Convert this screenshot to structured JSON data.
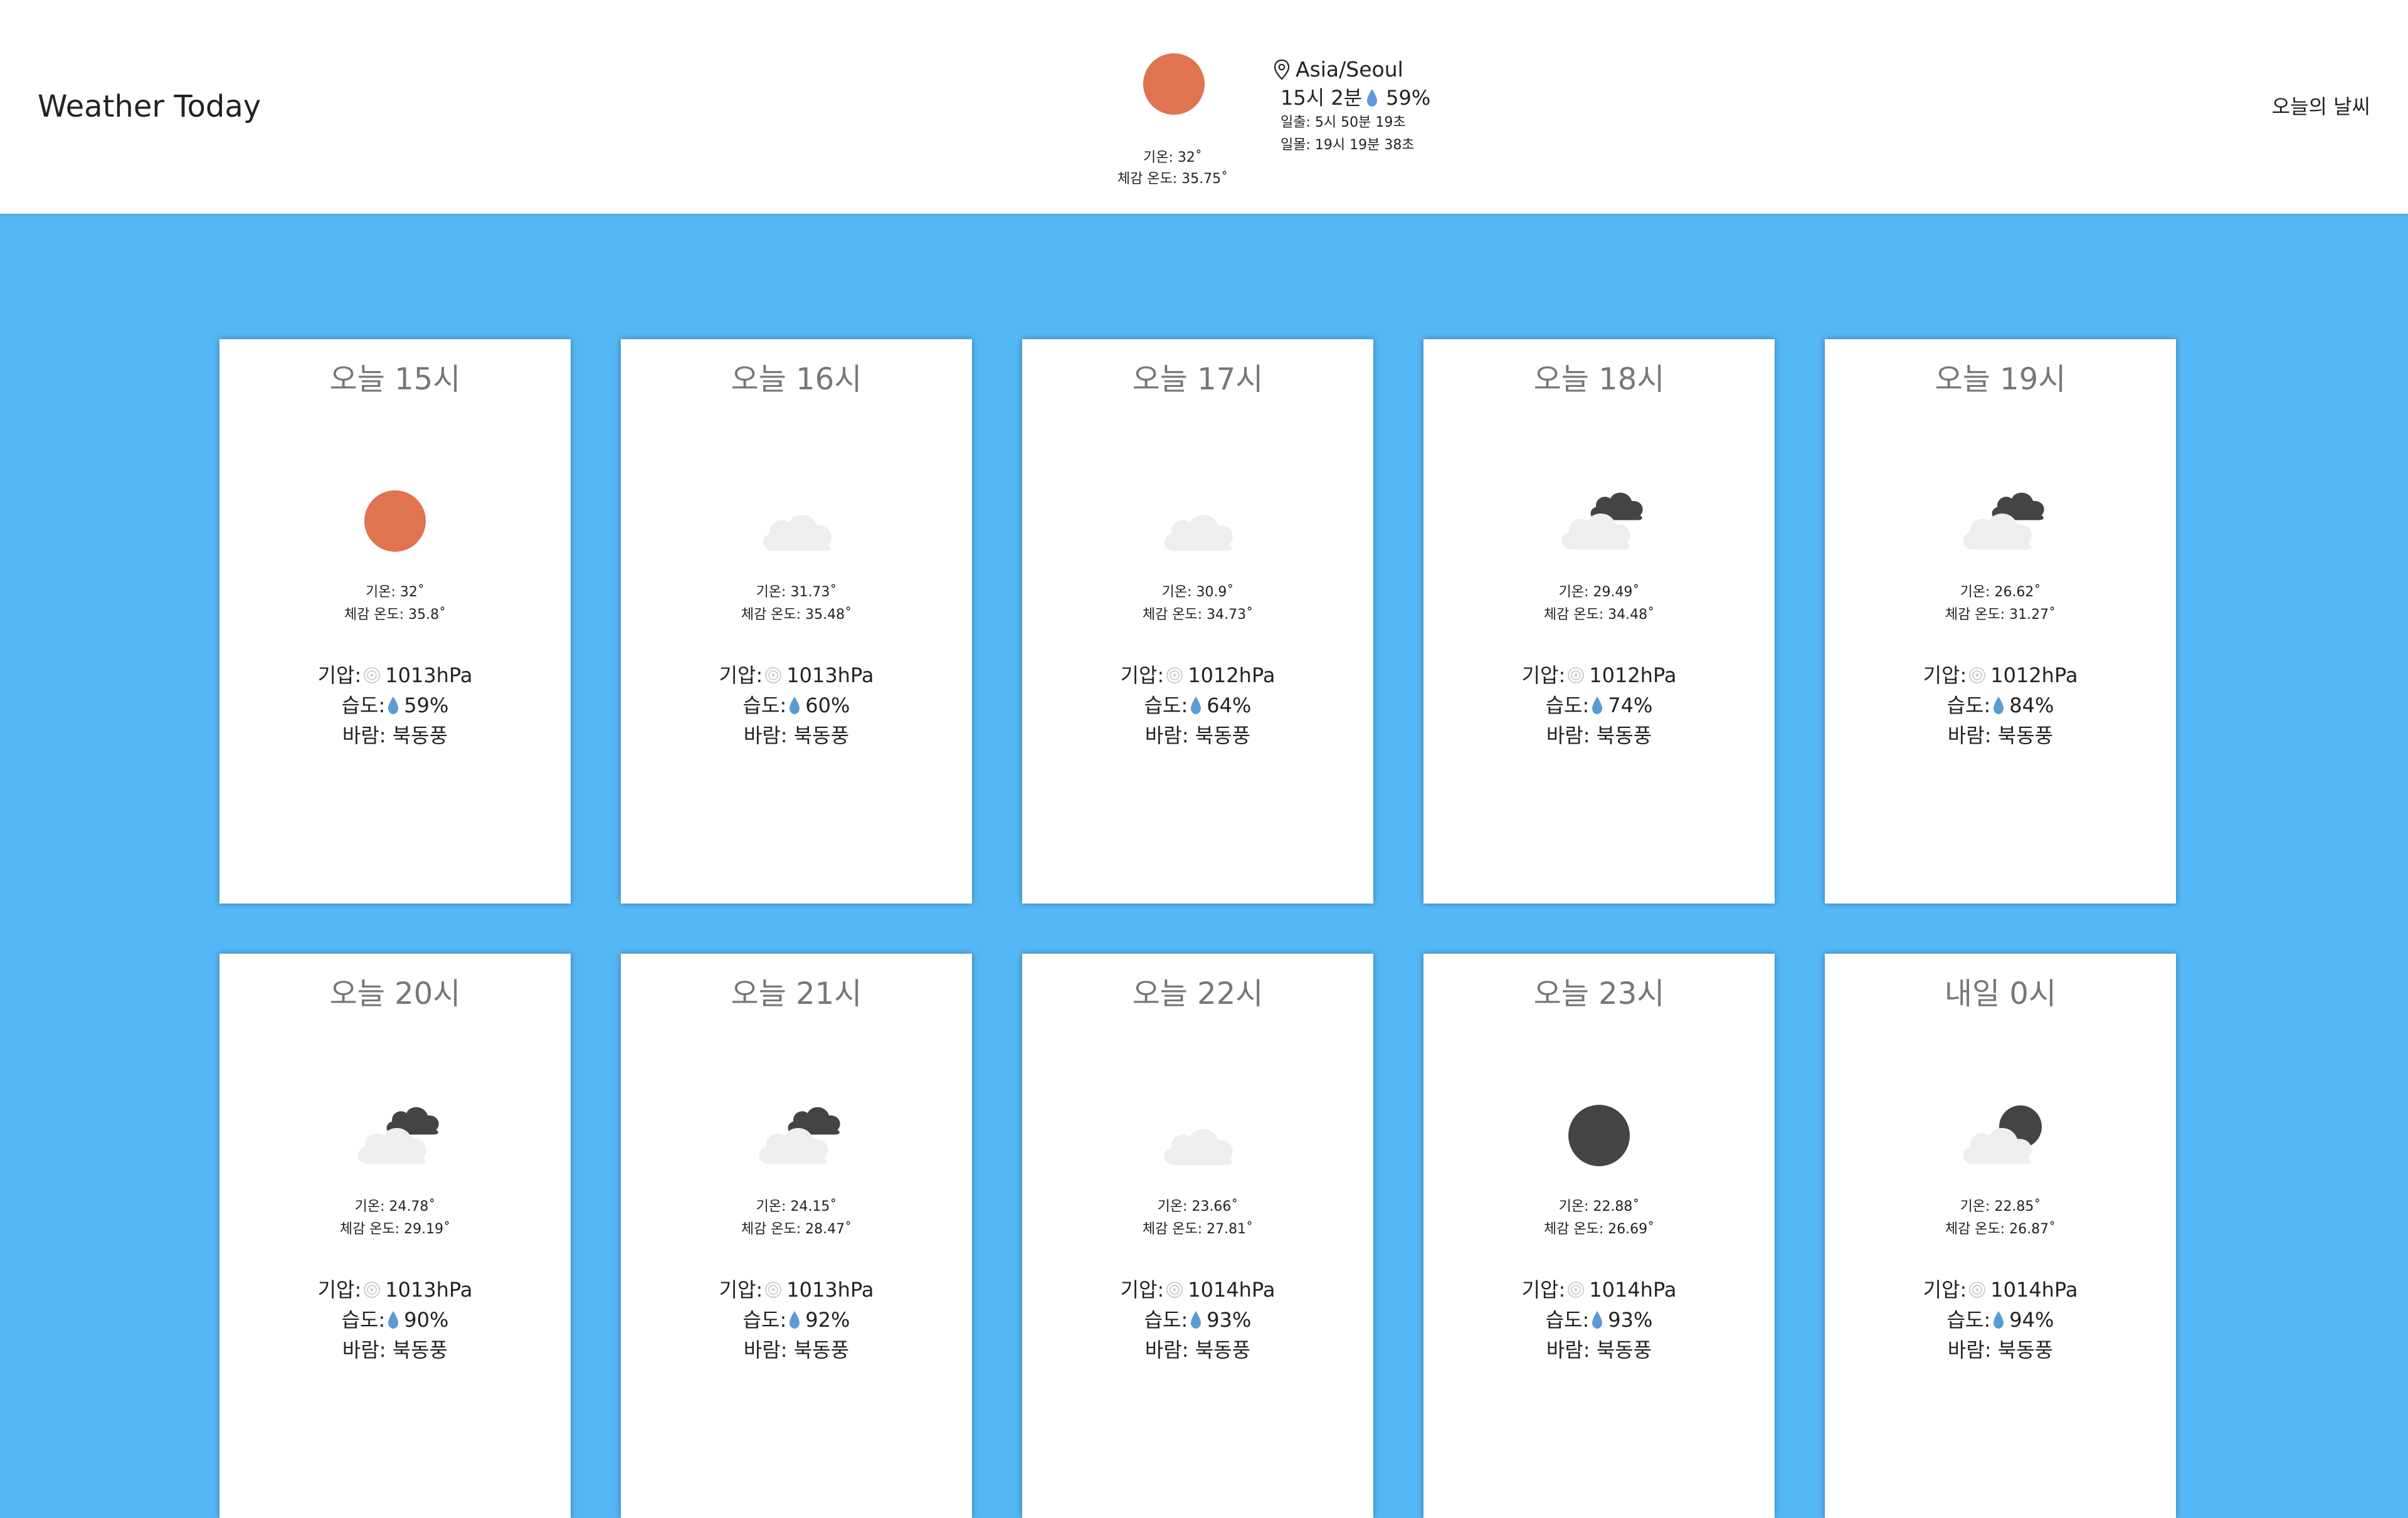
{
  "app": {
    "title": "Weather Today",
    "nav_link": "오늘의 날씨"
  },
  "current": {
    "icon": "sun-icon",
    "temp_label": "기온: 32˚",
    "feels_label": "체감 온도: 35.75˚",
    "location": "Asia/Seoul",
    "time": "15시 2분",
    "humidity": "59%",
    "sunrise": "일출: 5시 50분 19초",
    "sunset": "일몰: 19시 19분 38초"
  },
  "colors": {
    "background": "#55b8f6",
    "sun": "#e07350",
    "cloud_light": "#eeeeee",
    "cloud_dark": "#444444",
    "drop": "#5b9bd5"
  },
  "forecast": [
    {
      "title": "오늘 15시",
      "icon": "sun-icon",
      "temp": "기온: 32˚",
      "feels": "체감 온도: 35.8˚",
      "pressure_label": "기압:",
      "pressure": "1013hPa",
      "humidity_label": "습도:",
      "humidity": "59%",
      "wind": "바람: 북동풍"
    },
    {
      "title": "오늘 16시",
      "icon": "cloud-icon",
      "temp": "기온: 31.73˚",
      "feels": "체감 온도: 35.48˚",
      "pressure_label": "기압:",
      "pressure": "1013hPa",
      "humidity_label": "습도:",
      "humidity": "60%",
      "wind": "바람: 북동풍"
    },
    {
      "title": "오늘 17시",
      "icon": "cloud-icon",
      "temp": "기온: 30.9˚",
      "feels": "체감 온도: 34.73˚",
      "pressure_label": "기압:",
      "pressure": "1012hPa",
      "humidity_label": "습도:",
      "humidity": "64%",
      "wind": "바람: 북동풍"
    },
    {
      "title": "오늘 18시",
      "icon": "broken-clouds-icon",
      "temp": "기온: 29.49˚",
      "feels": "체감 온도: 34.48˚",
      "pressure_label": "기압:",
      "pressure": "1012hPa",
      "humidity_label": "습도:",
      "humidity": "74%",
      "wind": "바람: 북동풍"
    },
    {
      "title": "오늘 19시",
      "icon": "broken-clouds-icon",
      "temp": "기온: 26.62˚",
      "feels": "체감 온도: 31.27˚",
      "pressure_label": "기압:",
      "pressure": "1012hPa",
      "humidity_label": "습도:",
      "humidity": "84%",
      "wind": "바람: 북동풍"
    },
    {
      "title": "오늘 20시",
      "icon": "broken-clouds-icon",
      "temp": "기온: 24.78˚",
      "feels": "체감 온도: 29.19˚",
      "pressure_label": "기압:",
      "pressure": "1013hPa",
      "humidity_label": "습도:",
      "humidity": "90%",
      "wind": "바람: 북동풍"
    },
    {
      "title": "오늘 21시",
      "icon": "broken-clouds-icon",
      "temp": "기온: 24.15˚",
      "feels": "체감 온도: 28.47˚",
      "pressure_label": "기압:",
      "pressure": "1013hPa",
      "humidity_label": "습도:",
      "humidity": "92%",
      "wind": "바람: 북동풍"
    },
    {
      "title": "오늘 22시",
      "icon": "cloud-icon",
      "temp": "기온: 23.66˚",
      "feels": "체감 온도: 27.81˚",
      "pressure_label": "기압:",
      "pressure": "1014hPa",
      "humidity_label": "습도:",
      "humidity": "93%",
      "wind": "바람: 북동풍"
    },
    {
      "title": "오늘 23시",
      "icon": "moon-icon",
      "temp": "기온: 22.88˚",
      "feels": "체감 온도: 26.69˚",
      "pressure_label": "기압:",
      "pressure": "1014hPa",
      "humidity_label": "습도:",
      "humidity": "93%",
      "wind": "바람: 북동풍"
    },
    {
      "title": "내일 0시",
      "icon": "night-cloud-icon",
      "temp": "기온: 22.85˚",
      "feels": "체감 온도: 26.87˚",
      "pressure_label": "기압:",
      "pressure": "1014hPa",
      "humidity_label": "습도:",
      "humidity": "94%",
      "wind": "바람: 북동풍"
    }
  ]
}
